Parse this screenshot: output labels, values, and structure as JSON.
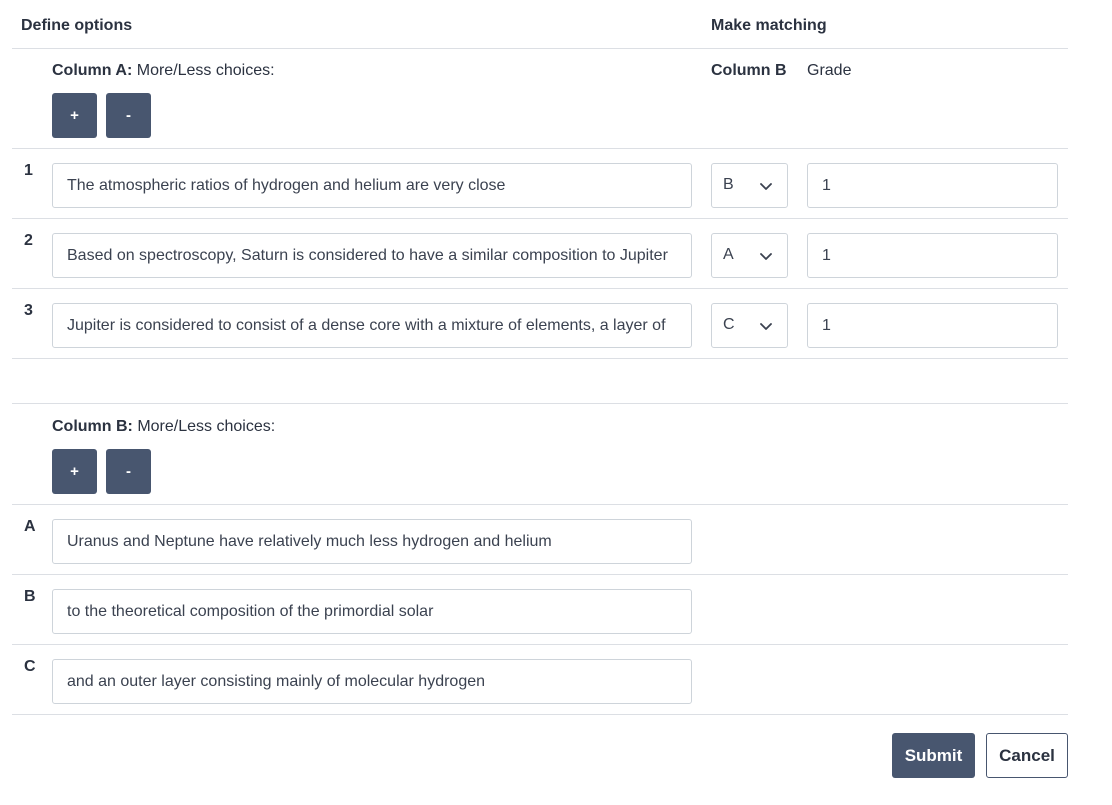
{
  "header": {
    "define_options": "Define options",
    "make_matching": "Make matching"
  },
  "column_a": {
    "title": "Column A:",
    "subtitle": "More/Less choices:",
    "plus_label": "+",
    "minus_label": "-",
    "rows": [
      {
        "num": "1",
        "text": "The atmospheric ratios of hydrogen and helium are very close",
        "match": "B",
        "grade": "1"
      },
      {
        "num": "2",
        "text": "Based on spectroscopy, Saturn is considered to have a similar composition to Jupiter",
        "match": "A",
        "grade": "1"
      },
      {
        "num": "3",
        "text": "Jupiter is considered to consist of a dense core with a mixture of elements, a layer of",
        "match": "C",
        "grade": "1"
      }
    ]
  },
  "matching_header": {
    "column_b": "Column B",
    "grade": "Grade"
  },
  "column_b": {
    "title": "Column B:",
    "subtitle": "More/Less choices:",
    "plus_label": "+",
    "minus_label": "-",
    "rows": [
      {
        "letter": "A",
        "text": "Uranus and Neptune have relatively much less hydrogen and helium"
      },
      {
        "letter": "B",
        "text": "to the theoretical composition of the primordial solar"
      },
      {
        "letter": "C",
        "text": "and an outer layer consisting mainly of molecular hydrogen"
      }
    ]
  },
  "actions": {
    "submit_label": "Submit",
    "cancel_label": "Cancel"
  },
  "colors": {
    "button_bg": "#48566f",
    "border": "#ced4da",
    "divider": "#dcdfe4",
    "text": "#2b3240"
  }
}
